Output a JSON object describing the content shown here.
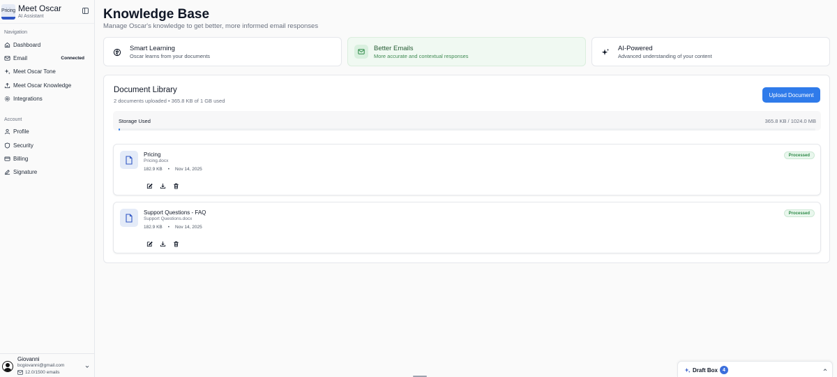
{
  "brand": {
    "logo_tag": "Pricing",
    "title": "Meet Oscar",
    "subtitle": "AI Assistant"
  },
  "sidebar": {
    "nav_label": "Navigation",
    "nav_items": [
      {
        "label": "Dashboard",
        "icon": "home-icon"
      },
      {
        "label": "Email",
        "icon": "mail-icon",
        "badge": "Connected"
      },
      {
        "label": "Meet Oscar Tone",
        "icon": "sparkles-icon"
      },
      {
        "label": "Meet Oscar Knowledge",
        "icon": "upload-icon"
      },
      {
        "label": "Integrations",
        "icon": "gear-icon"
      }
    ],
    "account_label": "Account",
    "account_items": [
      {
        "label": "Profile",
        "icon": "user-icon"
      },
      {
        "label": "Security",
        "icon": "shield-icon"
      },
      {
        "label": "Billing",
        "icon": "credit-card-icon"
      },
      {
        "label": "Signature",
        "icon": "signature-icon"
      }
    ]
  },
  "user": {
    "name": "Giovanni",
    "email": "bcgiovanni@gmail.com",
    "usage": "12.0/1500 emails"
  },
  "page": {
    "title": "Knowledge Base",
    "subtitle": "Manage Oscar's knowledge to get better, more informed email responses"
  },
  "features": [
    {
      "title": "Smart Learning",
      "desc": "Oscar learns from your documents",
      "icon": "brain-icon"
    },
    {
      "title": "Better Emails",
      "desc": "More accurate and contextual responses",
      "icon": "mail-icon"
    },
    {
      "title": "AI-Powered",
      "desc": "Advanced understanding of your content",
      "icon": "sparkles-icon"
    }
  ],
  "library": {
    "title": "Document Library",
    "subtitle": "2 documents uploaded • 365.8 KB of 1 GB used",
    "upload_label": "Upload Document",
    "storage_label": "Storage Used",
    "storage_value": "365.8 KB / 1024.0 MB",
    "storage_fraction": 0.0003
  },
  "documents": [
    {
      "name": "Pricing",
      "file": "Pricing.docx",
      "size": "182.9 KB",
      "date": "Nov 14, 2025",
      "status": "Processed"
    },
    {
      "name": "Support Questions - FAQ",
      "file": "Support Questions.docx",
      "size": "182.9 KB",
      "date": "Nov 14, 2025",
      "status": "Processed"
    }
  ],
  "draft_box": {
    "label": "Draft Box",
    "count": "4"
  },
  "colors": {
    "accent": "#2f7bea",
    "brand_bar": "#2f56c4",
    "status_green": "#2e8a48"
  }
}
